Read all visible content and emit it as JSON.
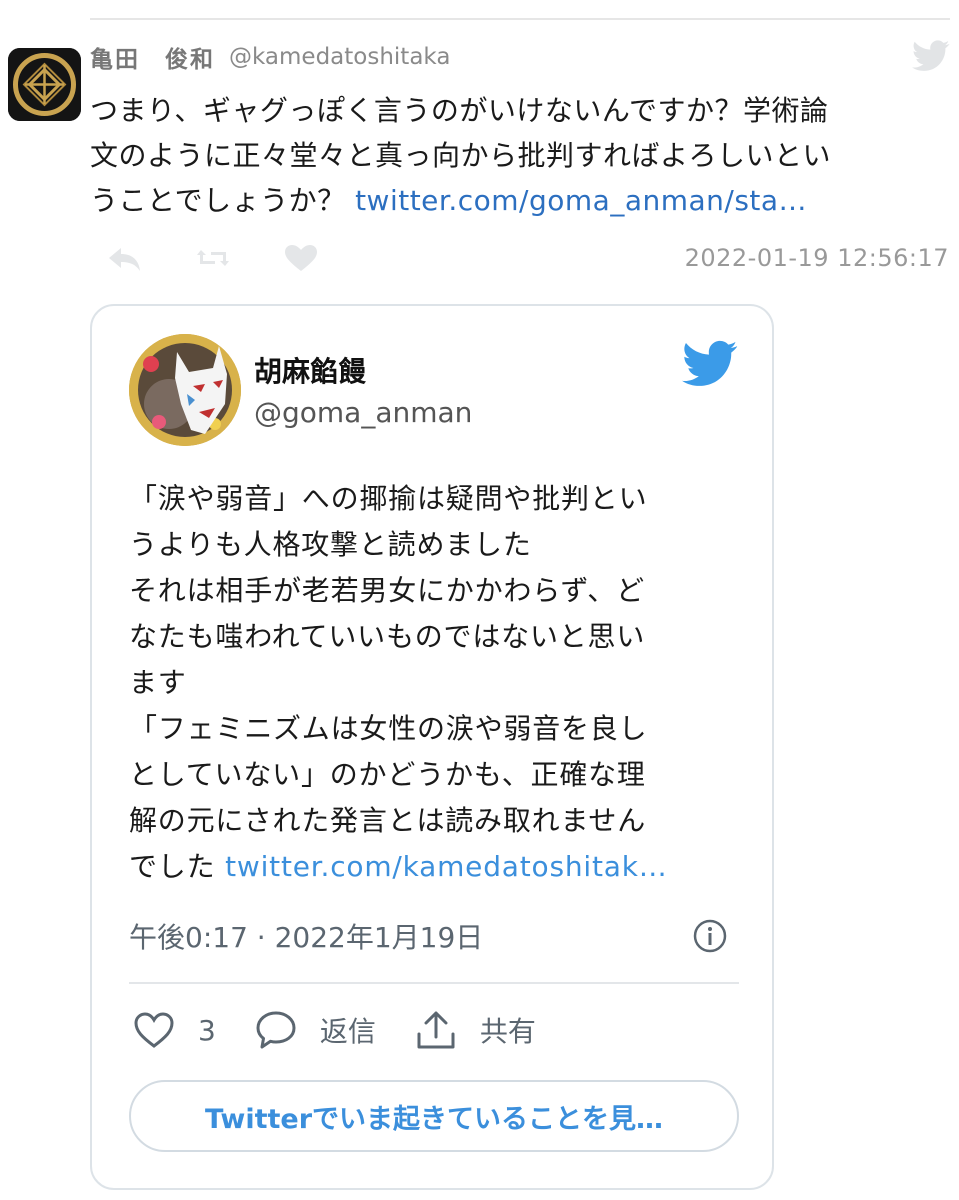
{
  "tweet": {
    "author_name": "亀田　俊和",
    "author_handle": "@kamedatoshitaka",
    "text_lines": [
      "つまり、ギャグっぽく言うのがいけないんですか？学術論",
      "文のように正々堂々と真っ向から批判すればよろしいとい",
      "うことでしょうか？ "
    ],
    "link": "twitter.com/goma_anman/sta…",
    "timestamp": "2022-01-19 12:56:17",
    "icons": [
      "reply-icon",
      "retweet-icon",
      "like-icon",
      "twitter-bird-icon"
    ]
  },
  "quoted": {
    "author_name": "胡麻餡饅",
    "author_handle": "@goma_anman",
    "text_lines": [
      "「涙や弱音」への揶揄は疑問や批判とい",
      "うよりも人格攻撃と読めました",
      "それは相手が老若男女にかかわらず、ど",
      "なたも嗤われていいものではないと思い",
      "ます",
      "「フェミニズムは女性の涙や弱音を良し",
      "としていない」のかどうかも、正確な理",
      "解の元にされた発言とは読み取れません",
      "でした "
    ],
    "link": "twitter.com/kamedatoshitak…",
    "timestamp": "午後0:17 · 2022年1月19日",
    "like_count": "3",
    "reply_label": "返信",
    "share_label": "共有",
    "cta_label": "Twitterでいま起きていることを見…",
    "colors": {
      "accent": "#3b8fdc",
      "link": "#2c6fc0"
    }
  }
}
